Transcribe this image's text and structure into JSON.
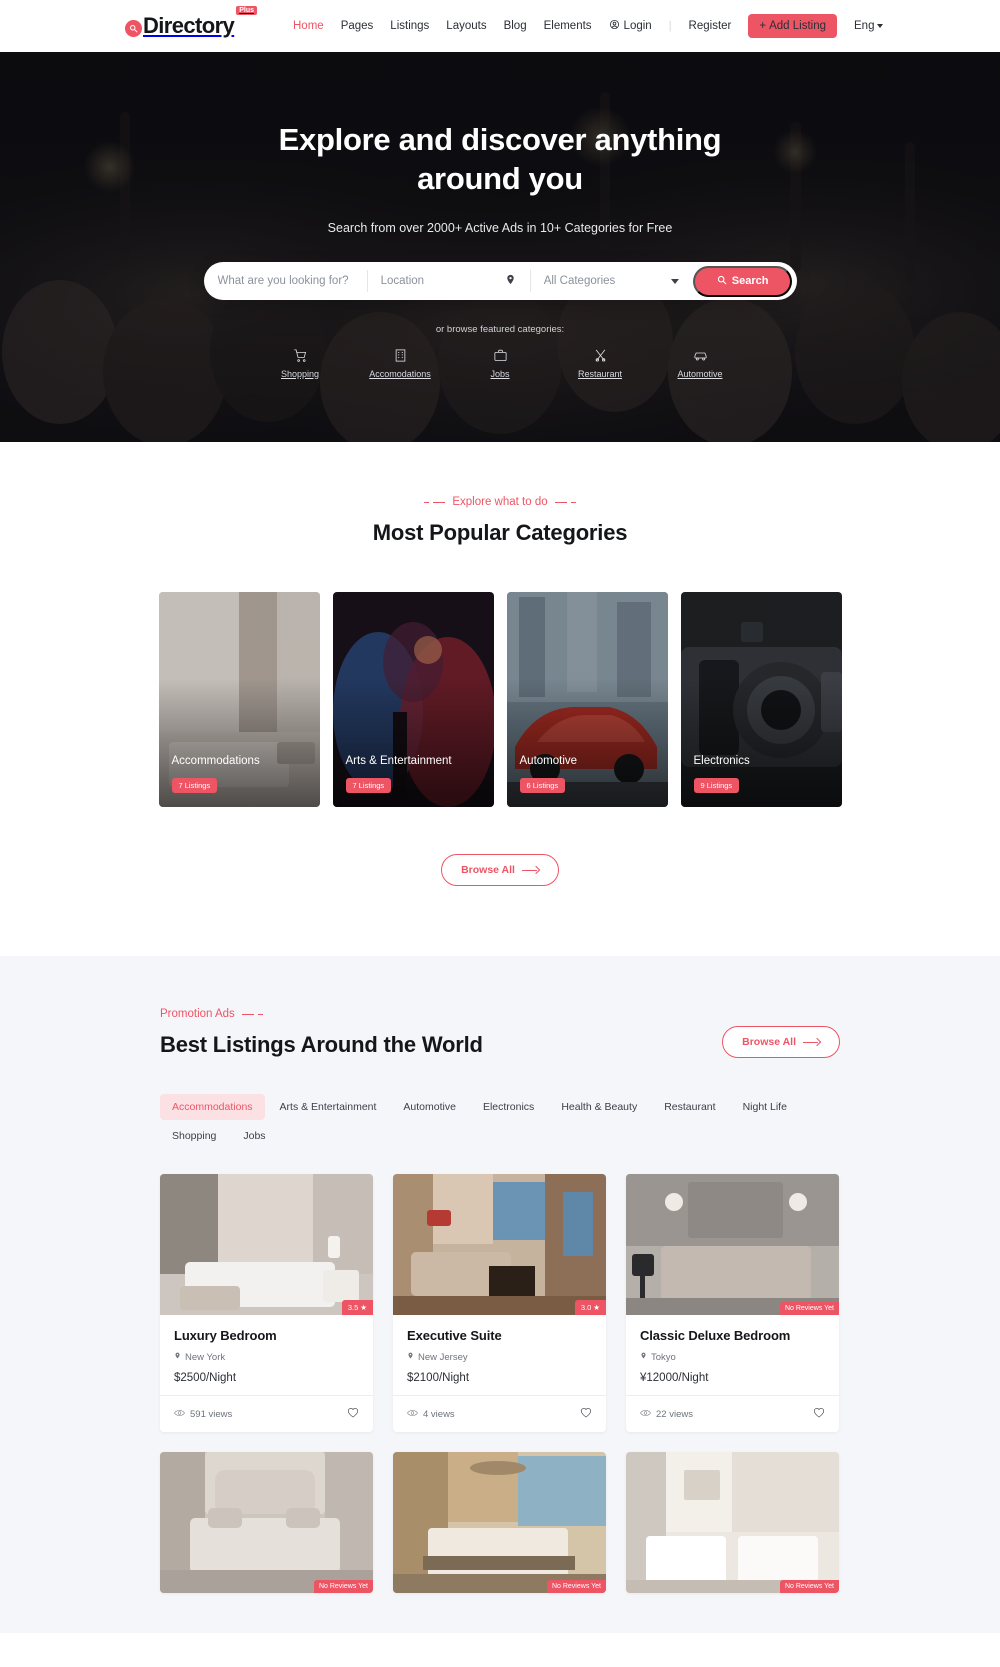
{
  "header": {
    "logo_text": "Directory",
    "logo_badge": "Plus",
    "logo_icon": "search-circle-icon",
    "nav": [
      {
        "label": "Home",
        "active": true
      },
      {
        "label": "Pages",
        "active": false
      },
      {
        "label": "Listings",
        "active": false
      },
      {
        "label": "Layouts",
        "active": false
      },
      {
        "label": "Blog",
        "active": false
      },
      {
        "label": "Elements",
        "active": false
      }
    ],
    "login_label": "Login",
    "login_icon": "user-circle-icon",
    "separator": "|",
    "register_label": "Register",
    "add_listing_label": "Add Listing",
    "add_listing_icon": "plus-icon",
    "language_label": "Eng",
    "language_icon": "chevron-down-icon",
    "accent_color": "#ed5565"
  },
  "hero": {
    "title": "Explore and discover anything around you",
    "subtitle": "Search from over 2000+ Active Ads in 10+ Categories for Free",
    "search": {
      "keyword_placeholder": "What are you looking for?",
      "keyword_value": "",
      "location_placeholder": "Location",
      "location_value": "",
      "location_icon": "map-pin-icon",
      "category_value": "All Categories",
      "category_icon": "chevron-down-icon",
      "button_label": "Search",
      "button_icon": "search-icon"
    },
    "browse_label": "or browse featured categories:",
    "categories": [
      {
        "label": "Shopping",
        "icon": "shopping-cart-icon"
      },
      {
        "label": "Accomodations",
        "icon": "building-icon"
      },
      {
        "label": "Jobs",
        "icon": "briefcase-icon"
      },
      {
        "label": "Restaurant",
        "icon": "fork-knife-icon"
      },
      {
        "label": "Automotive",
        "icon": "car-icon"
      }
    ]
  },
  "popular": {
    "eyebrow": "Explore what to do",
    "title": "Most Popular Categories",
    "cards": [
      {
        "name": "Accommodations",
        "badge": "7 Listings",
        "theme": "bedroom"
      },
      {
        "name": "Arts & Entertainment",
        "badge": "7 Listings",
        "theme": "concert"
      },
      {
        "name": "Automotive",
        "badge": "6 Listings",
        "theme": "car"
      },
      {
        "name": "Electronics",
        "badge": "9 Listings",
        "theme": "camera"
      }
    ],
    "browse_all_label": "Browse All"
  },
  "listings": {
    "eyebrow": "Promotion Ads",
    "title": "Best Listings Around the World",
    "browse_all_label": "Browse All",
    "tabs": [
      {
        "label": "Accommodations",
        "active": true
      },
      {
        "label": "Arts & Entertainment",
        "active": false
      },
      {
        "label": "Automotive",
        "active": false
      },
      {
        "label": "Electronics",
        "active": false
      },
      {
        "label": "Health & Beauty",
        "active": false
      },
      {
        "label": "Restaurant",
        "active": false
      },
      {
        "label": "Night Life",
        "active": false
      },
      {
        "label": "Shopping",
        "active": false
      },
      {
        "label": "Jobs",
        "active": false
      }
    ],
    "items": [
      {
        "title": "Luxury Bedroom",
        "location": "New York",
        "price": "$2500/Night",
        "rating": "3.5",
        "views": "591 views",
        "theme": "a"
      },
      {
        "title": "Executive Suite",
        "location": "New Jersey",
        "price": "$2100/Night",
        "rating": "3.0",
        "views": "4 views",
        "theme": "b"
      },
      {
        "title": "Classic Deluxe Bedroom",
        "location": "Tokyo",
        "price": "¥12000/Night",
        "rating": "No Reviews Yet",
        "views": "22 views",
        "theme": "c"
      },
      {
        "title": "",
        "location": "",
        "price": "",
        "rating": "No Reviews Yet",
        "views": "",
        "theme": "d"
      },
      {
        "title": "",
        "location": "",
        "price": "",
        "rating": "No Reviews Yet",
        "views": "",
        "theme": "e"
      },
      {
        "title": "",
        "location": "",
        "price": "",
        "rating": "No Reviews Yet",
        "views": "",
        "theme": "f"
      }
    ]
  }
}
